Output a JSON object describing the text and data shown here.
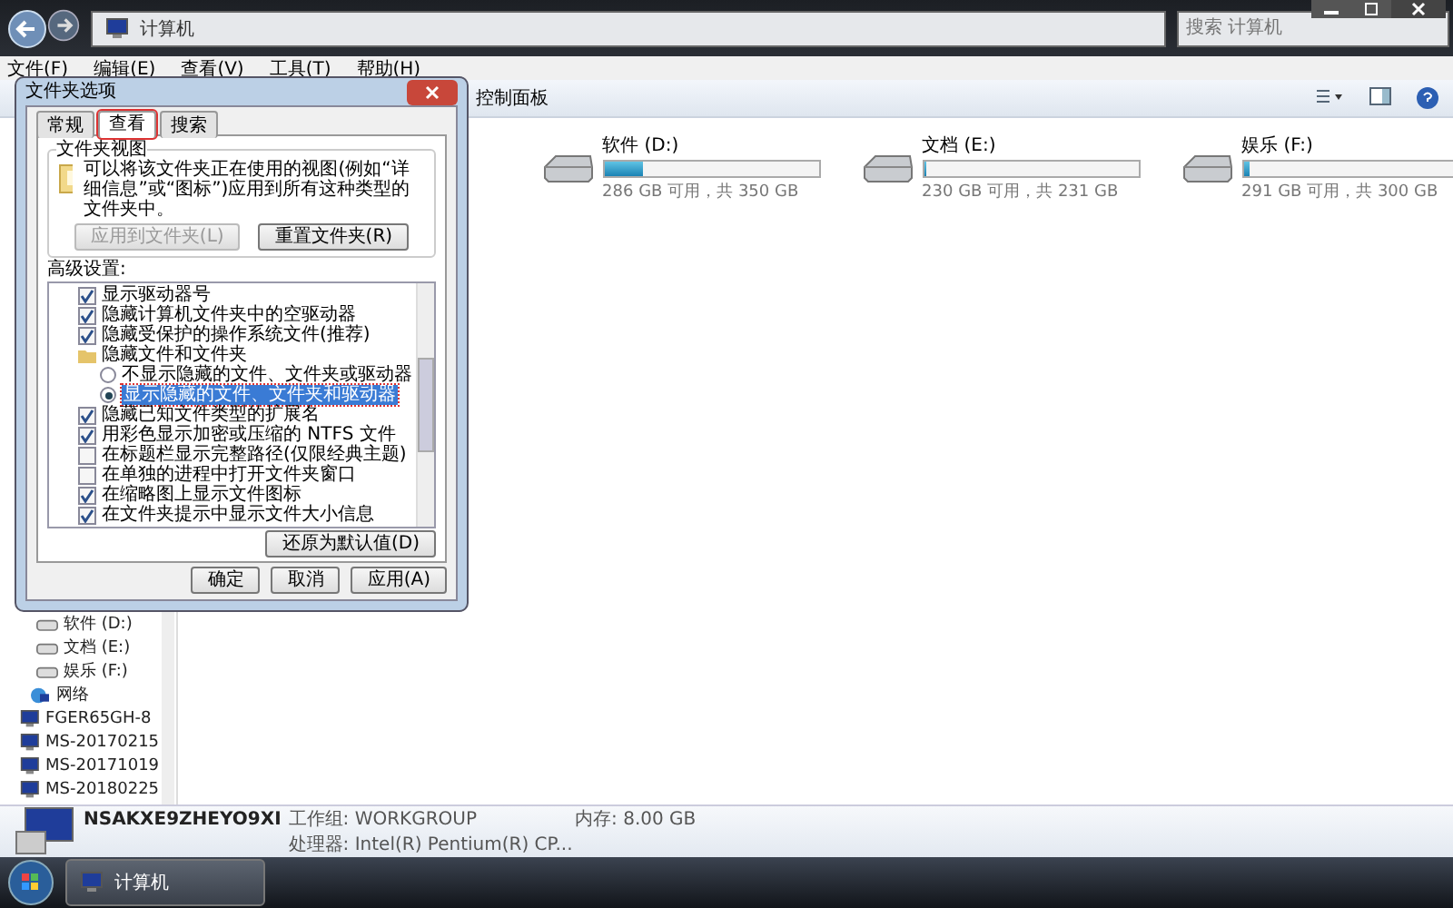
{
  "address_bar": {
    "path": "计算机"
  },
  "search": {
    "placeholder": "搜索 计算机"
  },
  "menu": [
    "文件(F)",
    "编辑(E)",
    "查看(V)",
    "工具(T)",
    "帮助(H)"
  ],
  "toolbar": {
    "items": [
      "控制面板"
    ]
  },
  "drives": [
    {
      "name": "软件 (D:)",
      "level": 0.18,
      "free": "286 GB 可用，共 350 GB"
    },
    {
      "name": "文档 (E:)",
      "level": 0.01,
      "free": "230 GB 可用，共 231 GB"
    },
    {
      "name": "娱乐 (F:)",
      "level": 0.03,
      "free": "291 GB 可用，共 300 GB"
    }
  ],
  "nav_pane": [
    {
      "label": "软件 (D:)",
      "kind": "drive"
    },
    {
      "label": "文档 (E:)",
      "kind": "drive"
    },
    {
      "label": "娱乐 (F:)",
      "kind": "drive"
    },
    {
      "label": "网络",
      "kind": "network"
    },
    {
      "label": "FGER65GH-8",
      "kind": "computer"
    },
    {
      "label": "MS-20170215",
      "kind": "computer"
    },
    {
      "label": "MS-20171019",
      "kind": "computer"
    },
    {
      "label": "MS-20180225",
      "kind": "computer"
    }
  ],
  "details": {
    "name": "NSAKXE9ZHEYO9XI",
    "workgroup": "工作组: WORKGROUP",
    "memory": "内存: 8.00 GB",
    "processor": "处理器: Intel(R) Pentium(R) CP..."
  },
  "taskbar": {
    "items": [
      "计算机"
    ]
  },
  "dialog": {
    "title": "文件夹选项",
    "tabs": [
      {
        "label": "常规",
        "selected": false
      },
      {
        "label": "查看",
        "selected": true
      },
      {
        "label": "搜索",
        "selected": false
      }
    ],
    "folder_views": {
      "title": "文件夹视图",
      "text": "可以将该文件夹正在使用的视图(例如“详细信息”或“图标”)应用到所有这种类型的文件夹中。",
      "buttons": [
        {
          "label": "应用到文件夹(L)",
          "disabled": true
        },
        {
          "label": "重置文件夹(R)",
          "disabled": false
        }
      ]
    },
    "advanced_label": "高级设置:",
    "settings": [
      {
        "kind": "checkbox",
        "label": "显示驱动器号",
        "checked": true
      },
      {
        "kind": "checkbox",
        "label": "隐藏计算机文件夹中的空驱动器",
        "checked": true
      },
      {
        "kind": "checkbox",
        "label": "隐藏受保护的操作系统文件(推荐)",
        "checked": true
      },
      {
        "kind": "folder",
        "label": "隐藏文件和文件夹",
        "children": [
          {
            "kind": "radio",
            "label": "不显示隐藏的文件、文件夹或驱动器",
            "selected": false
          },
          {
            "kind": "radio",
            "label": "显示隐藏的文件、文件夹和驱动器",
            "selected": true
          }
        ]
      },
      {
        "kind": "checkbox",
        "label": "隐藏已知文件类型的扩展名",
        "checked": true
      },
      {
        "kind": "checkbox",
        "label": "用彩色显示加密或压缩的 NTFS 文件",
        "checked": true
      },
      {
        "kind": "checkbox",
        "label": "在标题栏显示完整路径(仅限经典主题)",
        "checked": false
      },
      {
        "kind": "checkbox",
        "label": "在单独的进程中打开文件夹窗口",
        "checked": false
      },
      {
        "kind": "checkbox",
        "label": "在缩略图上显示文件图标",
        "checked": true
      },
      {
        "kind": "checkbox",
        "label": "在文件夹提示中显示文件大小信息",
        "checked": true
      }
    ],
    "restore_button": "还原为默认值(D)",
    "buttons": [
      "确定",
      "取消",
      "应用(A)"
    ]
  }
}
